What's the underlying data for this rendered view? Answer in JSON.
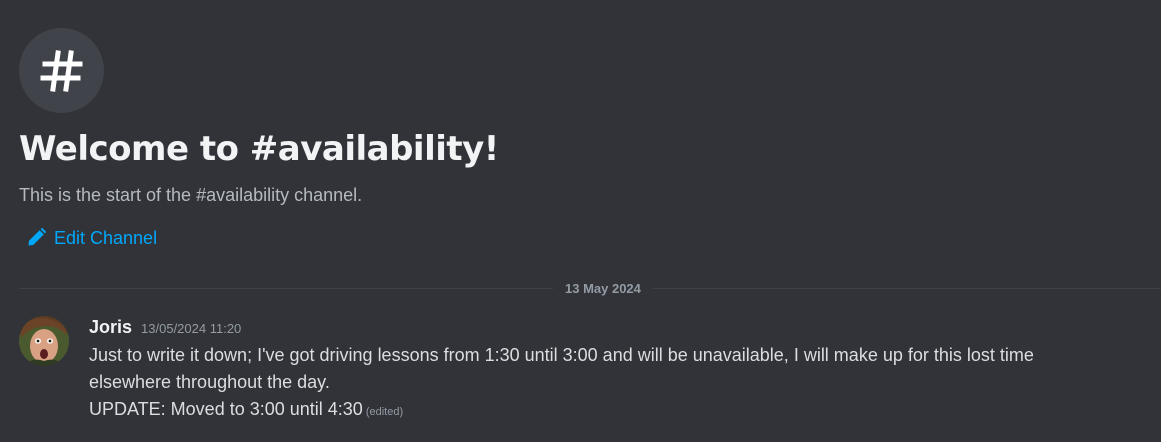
{
  "welcome": {
    "icon": "hashtag-icon",
    "title": "Welcome to #availability!",
    "subtitle": "This is the start of the #availability channel.",
    "edit_label": "Edit Channel"
  },
  "divider": {
    "date": "13 May 2024"
  },
  "message": {
    "author": "Joris",
    "timestamp": "13/05/2024 11:20",
    "lines": [
      "Just to write it down; I've got driving lessons from 1:30 until 3:00 and will be unavailable, I will make up for this lost time",
      "elsewhere throughout the day.",
      "UPDATE: Moved to 3:00 until 4:30"
    ],
    "edited_label": "(edited)"
  },
  "colors": {
    "background": "#313338",
    "link": "#00a8fc",
    "text": "#dbdee1",
    "muted": "#949ba4"
  }
}
